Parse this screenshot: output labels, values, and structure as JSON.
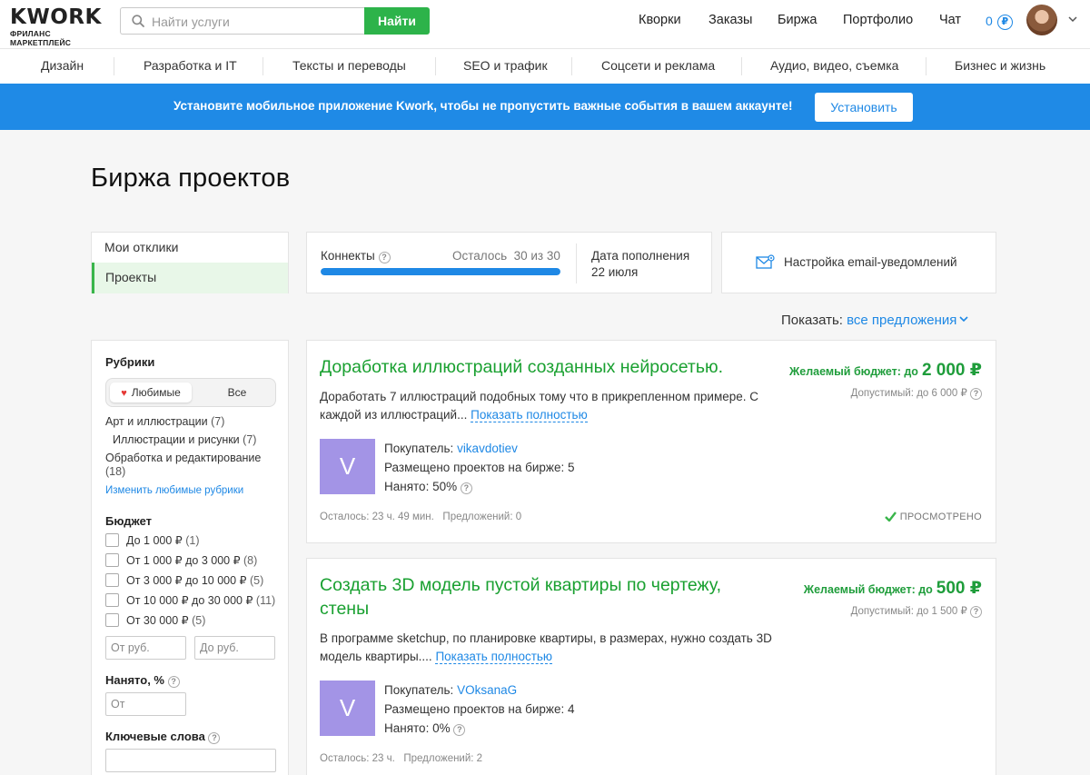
{
  "header": {
    "logo_word": "KWORK",
    "logo_sub": "ФРИЛАНС МАРКЕТПЛЕЙС",
    "search_placeholder": "Найти услуги",
    "search_button": "Найти",
    "nav": [
      "Кворки",
      "Заказы",
      "Биржа",
      "Портфолио",
      "Чат"
    ],
    "balance": "0",
    "currency_symbol": "₽"
  },
  "categories": [
    "Дизайн",
    "Разработка и IT",
    "Тексты и переводы",
    "SEO и трафик",
    "Соцсети и реклама",
    "Аудио, видео, съемка",
    "Бизнес и жизнь"
  ],
  "promo": {
    "text": "Установите мобильное приложение Kwork, чтобы не пропустить важные события в вашем аккаунте!",
    "button": "Установить"
  },
  "page_title": "Биржа проектов",
  "left_menu": [
    "Мои отклики",
    "Проекты"
  ],
  "connects": {
    "label": "Коннекты",
    "remaining": "Осталось  30 из 30",
    "fill_fraction": 1.0,
    "refill_label": "Дата пополнения",
    "refill_date": "22 июля"
  },
  "email_settings": "Настройка email-уведомлений",
  "show": {
    "label": "Показать:",
    "value": "все предложения"
  },
  "filters": {
    "rubrics_title": "Рубрики",
    "seg_favorites": "Любимые",
    "seg_all": "Все",
    "rubrics": [
      {
        "name": "Арт и иллюстрации",
        "count": "(7)"
      },
      {
        "name": "Иллюстрации и рисунки",
        "count": "(7)"
      },
      {
        "name": "Обработка и редактирование",
        "count": "(18)"
      }
    ],
    "edit_rubrics": "Изменить любимые рубрики",
    "budget_title": "Бюджет",
    "budget_options": [
      {
        "label": "До 1 000 ₽",
        "count": "(1)"
      },
      {
        "label": "От 1 000 ₽ до 3 000 ₽",
        "count": "(8)"
      },
      {
        "label": "От 3 000 ₽ до 10 000 ₽",
        "count": "(5)"
      },
      {
        "label": "От 10 000 ₽ до 30 000 ₽",
        "count": "(11)"
      },
      {
        "label": "От 30 000 ₽",
        "count": "(5)"
      }
    ],
    "from_placeholder": "От руб.",
    "to_placeholder": "До руб.",
    "hired_title": "Нанято, %",
    "hired_placeholder": "От",
    "keywords_title": "Ключевые слова"
  },
  "projects": [
    {
      "title": "Доработка иллюстраций созданных нейросетью.",
      "budget_label": "Желаемый бюджет: до",
      "budget_amount": "2 000 ₽",
      "allowed": "Допустимый: до 6 000 ₽",
      "desc": "Доработать 7 иллюстраций подобных тому что в прикрепленном примере. С каждой из иллюстраций...",
      "more": "Показать полностью",
      "avatar_letter": "V",
      "buyer_label": "Покупатель:",
      "buyer": "vikavdotiev",
      "placed": "Размещено проектов на бирже: 5",
      "hired": "Нанято: 50%",
      "time_left": "Осталось: 23 ч. 49 мин.",
      "offers": "Предложений: 0",
      "viewed": "ПРОСМОТРЕНО"
    },
    {
      "title": "Создать 3D модель пустой квартиры по чертежу, стены",
      "budget_label": "Желаемый бюджет: до",
      "budget_amount": "500 ₽",
      "allowed": "Допустимый: до 1 500 ₽",
      "desc": "В программе sketchup, по планировке квартиры, в размерах, нужно создать 3D модель квартиры....",
      "more": "Показать полностью",
      "avatar_letter": "V",
      "buyer_label": "Покупатель:",
      "buyer": "VOksanaG",
      "placed": "Размещено проектов на бирже: 4",
      "hired": "Нанято: 0%",
      "time_left": "Осталось: 23 ч.",
      "offers": "Предложений: 2"
    }
  ]
}
